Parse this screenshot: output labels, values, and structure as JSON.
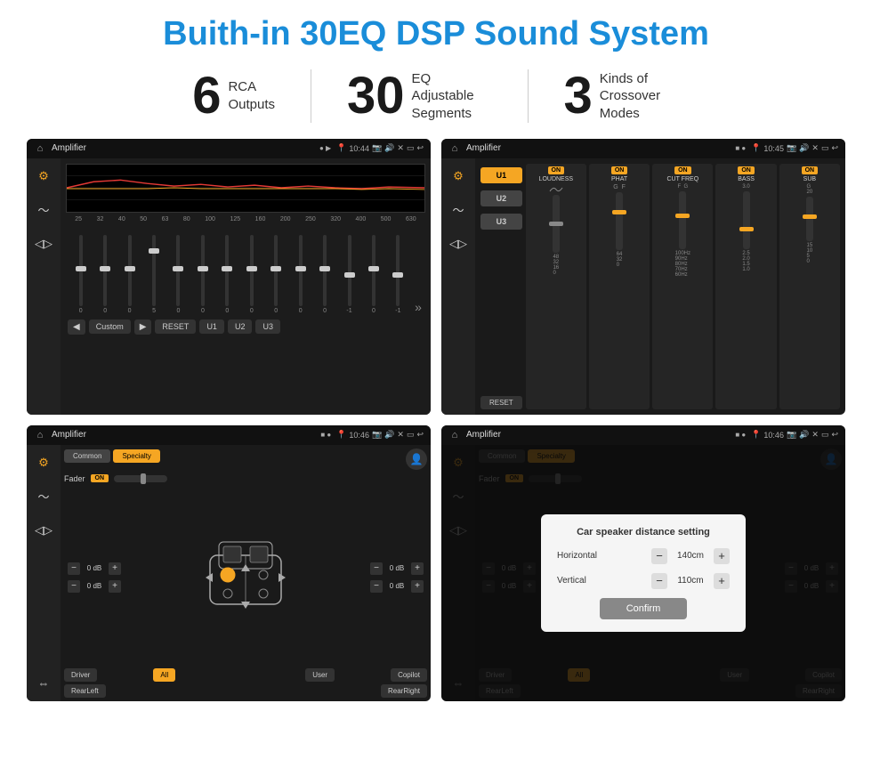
{
  "page": {
    "title": "Buith-in 30EQ DSP Sound System",
    "stats": [
      {
        "number": "6",
        "label": "RCA\nOutputs"
      },
      {
        "number": "30",
        "label": "EQ Adjustable\nSegments"
      },
      {
        "number": "3",
        "label": "Kinds of\nCrossover Modes"
      }
    ]
  },
  "screens": {
    "screen1": {
      "time": "10:44",
      "title": "Amplifier",
      "eq_freqs": [
        "25",
        "32",
        "40",
        "50",
        "63",
        "80",
        "100",
        "125",
        "160",
        "200",
        "250",
        "320",
        "400",
        "500",
        "630"
      ],
      "eq_vals": [
        "0",
        "0",
        "0",
        "5",
        "0",
        "0",
        "0",
        "0",
        "0",
        "0",
        "0",
        "-1",
        "0",
        "-1"
      ],
      "buttons": [
        "Custom",
        "RESET",
        "U1",
        "U2",
        "U3"
      ]
    },
    "screen2": {
      "time": "10:45",
      "title": "Amplifier",
      "u_buttons": [
        "U1",
        "U2",
        "U3"
      ],
      "controls": [
        "LOUDNESS",
        "PHAT",
        "CUT FREQ",
        "BASS",
        "SUB"
      ],
      "reset": "RESET"
    },
    "screen3": {
      "time": "10:46",
      "title": "Amplifier",
      "tabs": [
        "Common",
        "Specialty"
      ],
      "fader_label": "Fader",
      "db_values": [
        "0 dB",
        "0 dB",
        "0 dB",
        "0 dB"
      ],
      "buttons": [
        "Driver",
        "All",
        "User",
        "RearLeft",
        "RearRight",
        "Copilot"
      ]
    },
    "screen4": {
      "time": "10:46",
      "title": "Amplifier",
      "tabs": [
        "Common",
        "Specialty"
      ],
      "dialog": {
        "title": "Car speaker distance setting",
        "horizontal_label": "Horizontal",
        "horizontal_val": "140cm",
        "vertical_label": "Vertical",
        "vertical_val": "110cm",
        "confirm": "Confirm"
      },
      "db_values": [
        "0 dB",
        "0 dB"
      ],
      "buttons": [
        "Driver",
        "RearLeft",
        "User",
        "RearRight",
        "Copilot"
      ]
    }
  }
}
